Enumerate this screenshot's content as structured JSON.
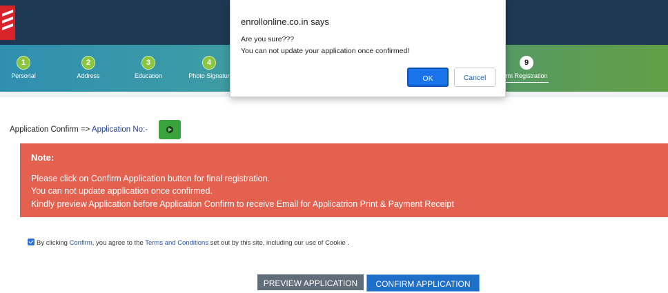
{
  "dialog": {
    "title": "enrollonline.co.in says",
    "question": "Are you sure???",
    "message": "You can not update your application once confirmed!",
    "ok_label": "OK",
    "cancel_label": "Cancel"
  },
  "steps": [
    {
      "num": "1",
      "label": "Personal"
    },
    {
      "num": "2",
      "label": "Address"
    },
    {
      "num": "3",
      "label": "Education"
    },
    {
      "num": "4",
      "label": "Photo Signatur"
    },
    {
      "num": "9",
      "label": "rm Registration"
    }
  ],
  "application": {
    "prefix": "Application Confirm => ",
    "app_no_label": "Application No:-"
  },
  "note": {
    "title": "Note:",
    "lines": [
      "Please click on Confirm Application button for final registration.",
      "You can not update application once confirmed.",
      "Kindly preview Application before Application Confirm to receive Email for Applicatrion Print & Payment Receipt"
    ]
  },
  "agreement": {
    "text_before": "By clicking ",
    "confirm_link": "Confirm",
    "text_middle": ", you agree to the ",
    "terms_link": "Terms and Conditions",
    "text_after": " set out by this site, including our use of Cookie ."
  },
  "buttons": {
    "preview_label": "PREVIEW APPLICATION",
    "confirm_label": "CONFIRM APPLICATION"
  },
  "colors": {
    "header": "#1e3854",
    "note_bg": "#e4604f",
    "confirm_btn": "#1f6fc9",
    "preview_btn": "#616d78",
    "step_circle": "#8cc63f"
  }
}
